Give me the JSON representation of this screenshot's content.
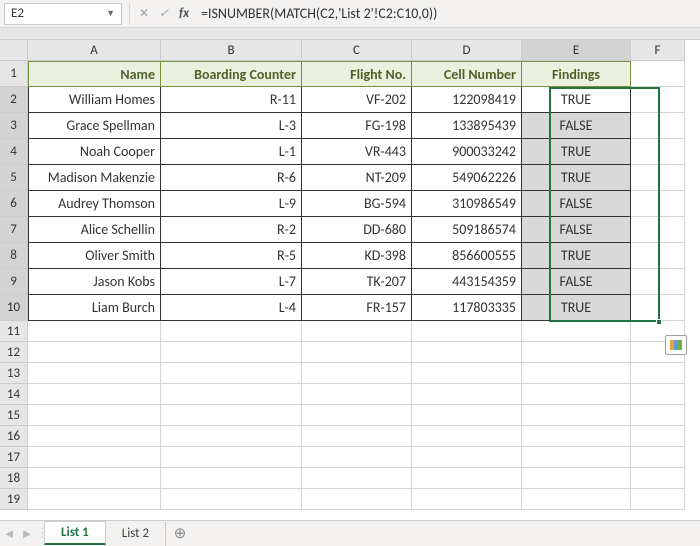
{
  "formula_bar": {
    "cell_ref": "E2",
    "formula": "=ISNUMBER(MATCH(C2,'List 2'!C2:C10,0))"
  },
  "columns": [
    "A",
    "B",
    "C",
    "D",
    "E",
    "F"
  ],
  "headers": {
    "A": "Name",
    "B": "Boarding Counter",
    "C": "Flight No.",
    "D": "Cell Number",
    "E": "Findings"
  },
  "rows": [
    {
      "n": "1"
    },
    {
      "n": "2",
      "A": "William Homes",
      "B": "R-11",
      "C": "VF-202",
      "D": "122098419",
      "E": "TRUE"
    },
    {
      "n": "3",
      "A": "Grace Spellman",
      "B": "L-3",
      "C": "FG-198",
      "D": "133895439",
      "E": "FALSE"
    },
    {
      "n": "4",
      "A": "Noah Cooper",
      "B": "L-1",
      "C": "VR-443",
      "D": "900033242",
      "E": "TRUE"
    },
    {
      "n": "5",
      "A": "Madison Makenzie",
      "B": "R-6",
      "C": "NT-209",
      "D": "549062226",
      "E": "TRUE"
    },
    {
      "n": "6",
      "A": "Audrey Thomson",
      "B": "L-9",
      "C": "BG-594",
      "D": "310986549",
      "E": "FALSE"
    },
    {
      "n": "7",
      "A": "Alice Schellin",
      "B": "R-2",
      "C": "DD-680",
      "D": "509186574",
      "E": "FALSE"
    },
    {
      "n": "8",
      "A": "Oliver Smith",
      "B": "R-5",
      "C": "KD-398",
      "D": "856600555",
      "E": "TRUE"
    },
    {
      "n": "9",
      "A": "Jason Kobs",
      "B": "L-7",
      "C": "TK-207",
      "D": "443154359",
      "E": "FALSE"
    },
    {
      "n": "10",
      "A": "Liam Burch",
      "B": "L-4",
      "C": "FR-157",
      "D": "117803335",
      "E": "TRUE"
    },
    {
      "n": "11"
    },
    {
      "n": "12"
    },
    {
      "n": "13"
    },
    {
      "n": "14"
    },
    {
      "n": "15"
    },
    {
      "n": "16"
    },
    {
      "n": "17"
    },
    {
      "n": "18"
    },
    {
      "n": "19"
    }
  ],
  "tabs": {
    "active": "List 1",
    "inactive": "List 2"
  },
  "chart_data": {
    "type": "table",
    "columns": [
      "Name",
      "Boarding Counter",
      "Flight No.",
      "Cell Number",
      "Findings"
    ],
    "rows": [
      [
        "William Homes",
        "R-11",
        "VF-202",
        122098419,
        "TRUE"
      ],
      [
        "Grace Spellman",
        "L-3",
        "FG-198",
        133895439,
        "FALSE"
      ],
      [
        "Noah Cooper",
        "L-1",
        "VR-443",
        900033242,
        "TRUE"
      ],
      [
        "Madison Makenzie",
        "R-6",
        "NT-209",
        549062226,
        "TRUE"
      ],
      [
        "Audrey Thomson",
        "L-9",
        "BG-594",
        310986549,
        "FALSE"
      ],
      [
        "Alice Schellin",
        "R-2",
        "DD-680",
        509186574,
        "FALSE"
      ],
      [
        "Oliver Smith",
        "R-5",
        "KD-398",
        856600555,
        "TRUE"
      ],
      [
        "Jason Kobs",
        "L-7",
        "TK-207",
        443154359,
        "FALSE"
      ],
      [
        "Liam Burch",
        "L-4",
        "FR-157",
        117803335,
        "TRUE"
      ]
    ]
  }
}
